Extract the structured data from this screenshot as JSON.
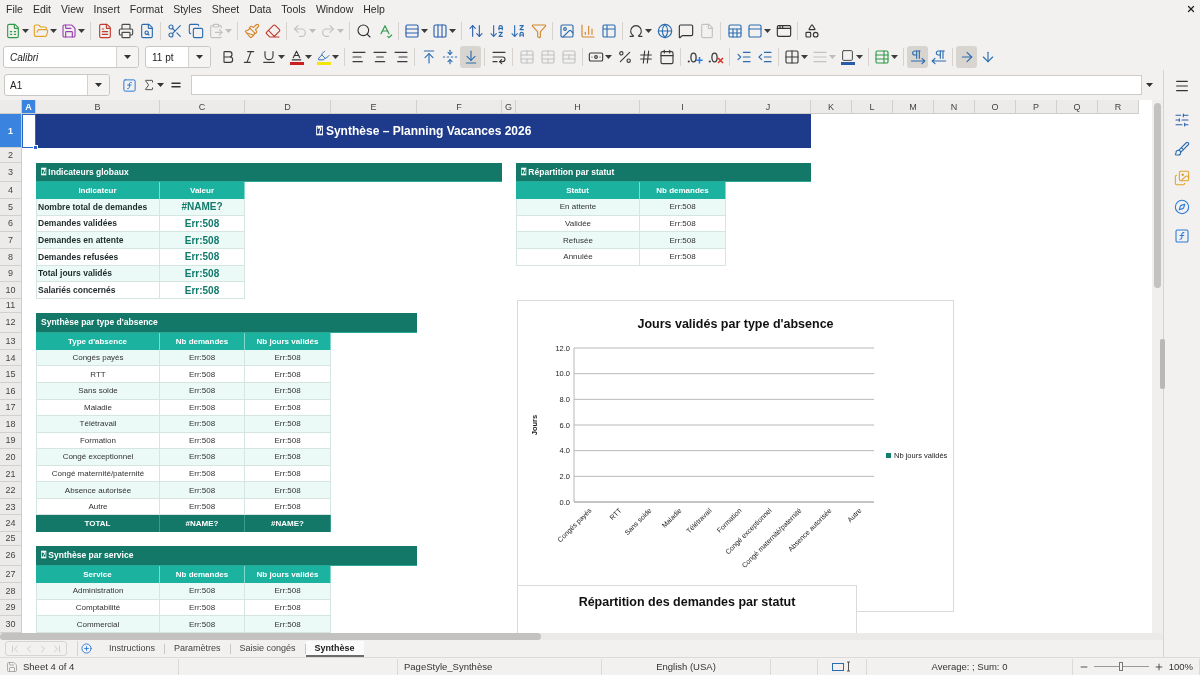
{
  "menu_bar": [
    "File",
    "Edit",
    "View",
    "Insert",
    "Format",
    "Styles",
    "Sheet",
    "Data",
    "Tools",
    "Window",
    "Help"
  ],
  "standard_toolbar": [
    {
      "disabled": false
    },
    {
      "disabled": false
    },
    {
      "disabled": false
    },
    {
      "disabled": false
    },
    {
      "disabled": false
    },
    {
      "disabled": false
    },
    {
      "disabled": false
    },
    {
      "disabled": false
    },
    {
      "disabled": true
    },
    {
      "disabled": false
    },
    {
      "disabled": false
    },
    {
      "disabled": true
    },
    {
      "disabled": true
    },
    {
      "disabled": false
    },
    {
      "disabled": false
    },
    {
      "disabled": false
    },
    {
      "disabled": false
    },
    {
      "disabled": false
    },
    {
      "disabled": false
    },
    {
      "disabled": false
    },
    {
      "disabled": false
    },
    {
      "disabled": false
    },
    {
      "disabled": false
    },
    {
      "disabled": false
    },
    {
      "disabled": false
    },
    {
      "disabled": false
    },
    {
      "disabled": false
    },
    {
      "disabled": true
    },
    {
      "disabled": false
    },
    {
      "disabled": false
    },
    {
      "disabled": false
    },
    {
      "disabled": false
    }
  ],
  "formatting_toolbar": {
    "font_name": "Calibri",
    "font_size": "11 pt",
    "buttons": [
      {
        "on": false,
        "disabled": false
      },
      {
        "on": false,
        "disabled": false
      },
      {
        "on": false,
        "disabled": false
      },
      {
        "on": false,
        "disabled": false
      },
      {
        "on": false,
        "disabled": false
      },
      {
        "on": false,
        "disabled": false
      },
      {
        "on": false,
        "disabled": false
      },
      {
        "on": false,
        "disabled": false
      },
      {
        "on": false,
        "disabled": false
      },
      {
        "on": false,
        "disabled": false
      },
      {
        "on": true,
        "disabled": false
      },
      {
        "on": false,
        "disabled": false
      },
      {
        "on": false,
        "disabled": true
      },
      {
        "on": false,
        "disabled": true
      },
      {
        "on": false,
        "disabled": true
      },
      {
        "on": false,
        "disabled": false
      },
      {
        "on": false,
        "disabled": false
      },
      {
        "on": false,
        "disabled": false
      },
      {
        "on": false,
        "disabled": false
      },
      {
        "on": false,
        "disabled": false
      },
      {
        "on": false,
        "disabled": false
      },
      {
        "on": false,
        "disabled": false
      },
      {
        "on": false,
        "disabled": false
      },
      {
        "on": false,
        "disabled": false
      },
      {
        "on": false,
        "disabled": true
      },
      {
        "on": false,
        "disabled": false
      },
      {
        "on": false,
        "disabled": false
      },
      {
        "on": true,
        "disabled": false
      },
      {
        "on": false,
        "disabled": false
      },
      {
        "on": true,
        "disabled": false
      },
      {
        "on": false,
        "disabled": false
      }
    ]
  },
  "formula_bar": {
    "name_box": "A1"
  },
  "sheet": {
    "columns": [
      {
        "label": "A",
        "selected": true
      },
      {
        "label": "B",
        "selected": false
      },
      {
        "label": "C",
        "selected": false
      },
      {
        "label": "D",
        "selected": false
      },
      {
        "label": "E",
        "selected": false
      },
      {
        "label": "F",
        "selected": false
      },
      {
        "label": "G",
        "selected": false
      },
      {
        "label": "H",
        "selected": false
      },
      {
        "label": "I",
        "selected": false
      },
      {
        "label": "J",
        "selected": false
      },
      {
        "label": "K",
        "selected": false
      },
      {
        "label": "L",
        "selected": false
      },
      {
        "label": "M",
        "selected": false
      },
      {
        "label": "N",
        "selected": false
      },
      {
        "label": "O",
        "selected": false
      },
      {
        "label": "P",
        "selected": false
      },
      {
        "label": "Q",
        "selected": false
      },
      {
        "label": "R",
        "selected": false
      }
    ],
    "rows": [
      {
        "label": "1",
        "selected": true
      },
      {
        "label": "2",
        "selected": false
      },
      {
        "label": "3",
        "selected": false
      },
      {
        "label": "4",
        "selected": false
      },
      {
        "label": "5",
        "selected": false
      },
      {
        "label": "6",
        "selected": false
      },
      {
        "label": "7",
        "selected": false
      },
      {
        "label": "8",
        "selected": false
      },
      {
        "label": "9",
        "selected": false
      },
      {
        "label": "10",
        "selected": false
      },
      {
        "label": "11",
        "selected": false
      },
      {
        "label": "12",
        "selected": false
      },
      {
        "label": "13",
        "selected": false
      },
      {
        "label": "14",
        "selected": false
      },
      {
        "label": "15",
        "selected": false
      },
      {
        "label": "16",
        "selected": false
      },
      {
        "label": "17",
        "selected": false
      },
      {
        "label": "18",
        "selected": false
      },
      {
        "label": "19",
        "selected": false
      },
      {
        "label": "20",
        "selected": false
      },
      {
        "label": "21",
        "selected": false
      },
      {
        "label": "22",
        "selected": false
      },
      {
        "label": "23",
        "selected": false
      },
      {
        "label": "24",
        "selected": false
      },
      {
        "label": "25",
        "selected": false
      },
      {
        "label": "26",
        "selected": false
      },
      {
        "label": "27",
        "selected": false
      },
      {
        "label": "28",
        "selected": false
      },
      {
        "label": "29",
        "selected": false
      },
      {
        "label": "30",
        "selected": false
      }
    ],
    "title": "⍰ Synthèse – Planning Vacances 2026",
    "blocks": [
      {
        "kind": "kpi",
        "heading": "⍰ Indicateurs globaux",
        "columns": [
          "Indicateur",
          "Valeur"
        ],
        "rows": [
          [
            "Nombre total de demandes",
            "#NAME?"
          ],
          [
            "Demandes validées",
            "Err:508"
          ],
          [
            "Demandes en attente",
            "Err:508"
          ],
          [
            "Demandes refusées",
            "Err:508"
          ],
          [
            "Total jours validés",
            "Err:508"
          ],
          [
            "Salariés concernés",
            "Err:508"
          ]
        ]
      },
      {
        "kind": "summary",
        "heading": "⍰ Répartition par statut",
        "columns": [
          "Statut",
          "Nb demandes"
        ],
        "rows": [
          [
            "En attente",
            "Err:508"
          ],
          [
            "Validée",
            "Err:508"
          ],
          [
            "Refusée",
            "Err:508"
          ],
          [
            "Annulée",
            "Err:508"
          ]
        ]
      },
      {
        "kind": "summary",
        "heading": "Synthèse par type d'absence",
        "columns": [
          "Type d'absence",
          "Nb demandes",
          "Nb jours validés"
        ],
        "rows": [
          [
            "Congés payés",
            "Err:508",
            "Err:508"
          ],
          [
            "RTT",
            "Err:508",
            "Err:508"
          ],
          [
            "Sans solde",
            "Err:508",
            "Err:508"
          ],
          [
            "Maladie",
            "Err:508",
            "Err:508"
          ],
          [
            "Télétravail",
            "Err:508",
            "Err:508"
          ],
          [
            "Formation",
            "Err:508",
            "Err:508"
          ],
          [
            "Congé exceptionnel",
            "Err:508",
            "Err:508"
          ],
          [
            "Congé maternité/paternité",
            "Err:508",
            "Err:508"
          ],
          [
            "Absence autorisée",
            "Err:508",
            "Err:508"
          ],
          [
            "Autre",
            "Err:508",
            "Err:508"
          ]
        ],
        "total": [
          "TOTAL",
          "#NAME?",
          "#NAME?"
        ]
      },
      {
        "kind": "summary",
        "heading": "⍰ Synthèse par service",
        "columns": [
          "Service",
          "Nb demandes",
          "Nb jours validés"
        ],
        "rows": [
          [
            "Administration",
            "Err:508",
            "Err:508"
          ],
          [
            "Comptabilité",
            "Err:508",
            "Err:508"
          ],
          [
            "Commercial",
            "Err:508",
            "Err:508"
          ]
        ]
      }
    ]
  },
  "charts": [
    {
      "kind": "bar",
      "chart_data": {
        "type": "bar",
        "title": "Jours validés par type d'absence",
        "ylabel": "Jours",
        "categories": [
          "Congés payés",
          "RTT",
          "Sans solde",
          "Maladie",
          "Télétravail",
          "Formation",
          "Congé exceptionnel",
          "Congé maternité/paternité",
          "Absence autorisée",
          "Autre"
        ],
        "series": [
          {
            "name": "Nb jours validés",
            "color": "#13806f",
            "values": [
              0,
              0,
              0,
              0,
              0,
              0,
              0,
              0,
              0,
              0
            ]
          }
        ],
        "ylim": [
          0,
          12
        ],
        "yticks": [
          {
            "value": 0,
            "label": "0.0"
          },
          {
            "value": 2,
            "label": "2.0"
          },
          {
            "value": 4,
            "label": "4.0"
          },
          {
            "value": 6,
            "label": "6.0"
          },
          {
            "value": 8,
            "label": "8.0"
          },
          {
            "value": 10,
            "label": "10.0"
          },
          {
            "value": 12,
            "label": "12.0"
          }
        ],
        "grid": true
      }
    },
    {
      "kind": "cut",
      "title": "Répartition des demandes par statut"
    }
  ],
  "sheet_nav": [
    {
      "disabled": true
    },
    {
      "disabled": true
    },
    {
      "disabled": true
    },
    {
      "disabled": true
    }
  ],
  "sheet_tabs": [
    {
      "label": "Instructions",
      "selected": false
    },
    {
      "label": "Paramètres",
      "selected": false
    },
    {
      "label": "Saisie congés",
      "selected": false
    },
    {
      "label": "Synthèse",
      "selected": true
    }
  ],
  "status_bar": {
    "sheet": "Sheet 4 of 4",
    "page_style": "PageStyle_Synthèse",
    "language": "English (USA)",
    "summary": "Average: ; Sum: 0",
    "zoom_slider": {
      "level": 0.5
    },
    "zoom": "100%"
  }
}
